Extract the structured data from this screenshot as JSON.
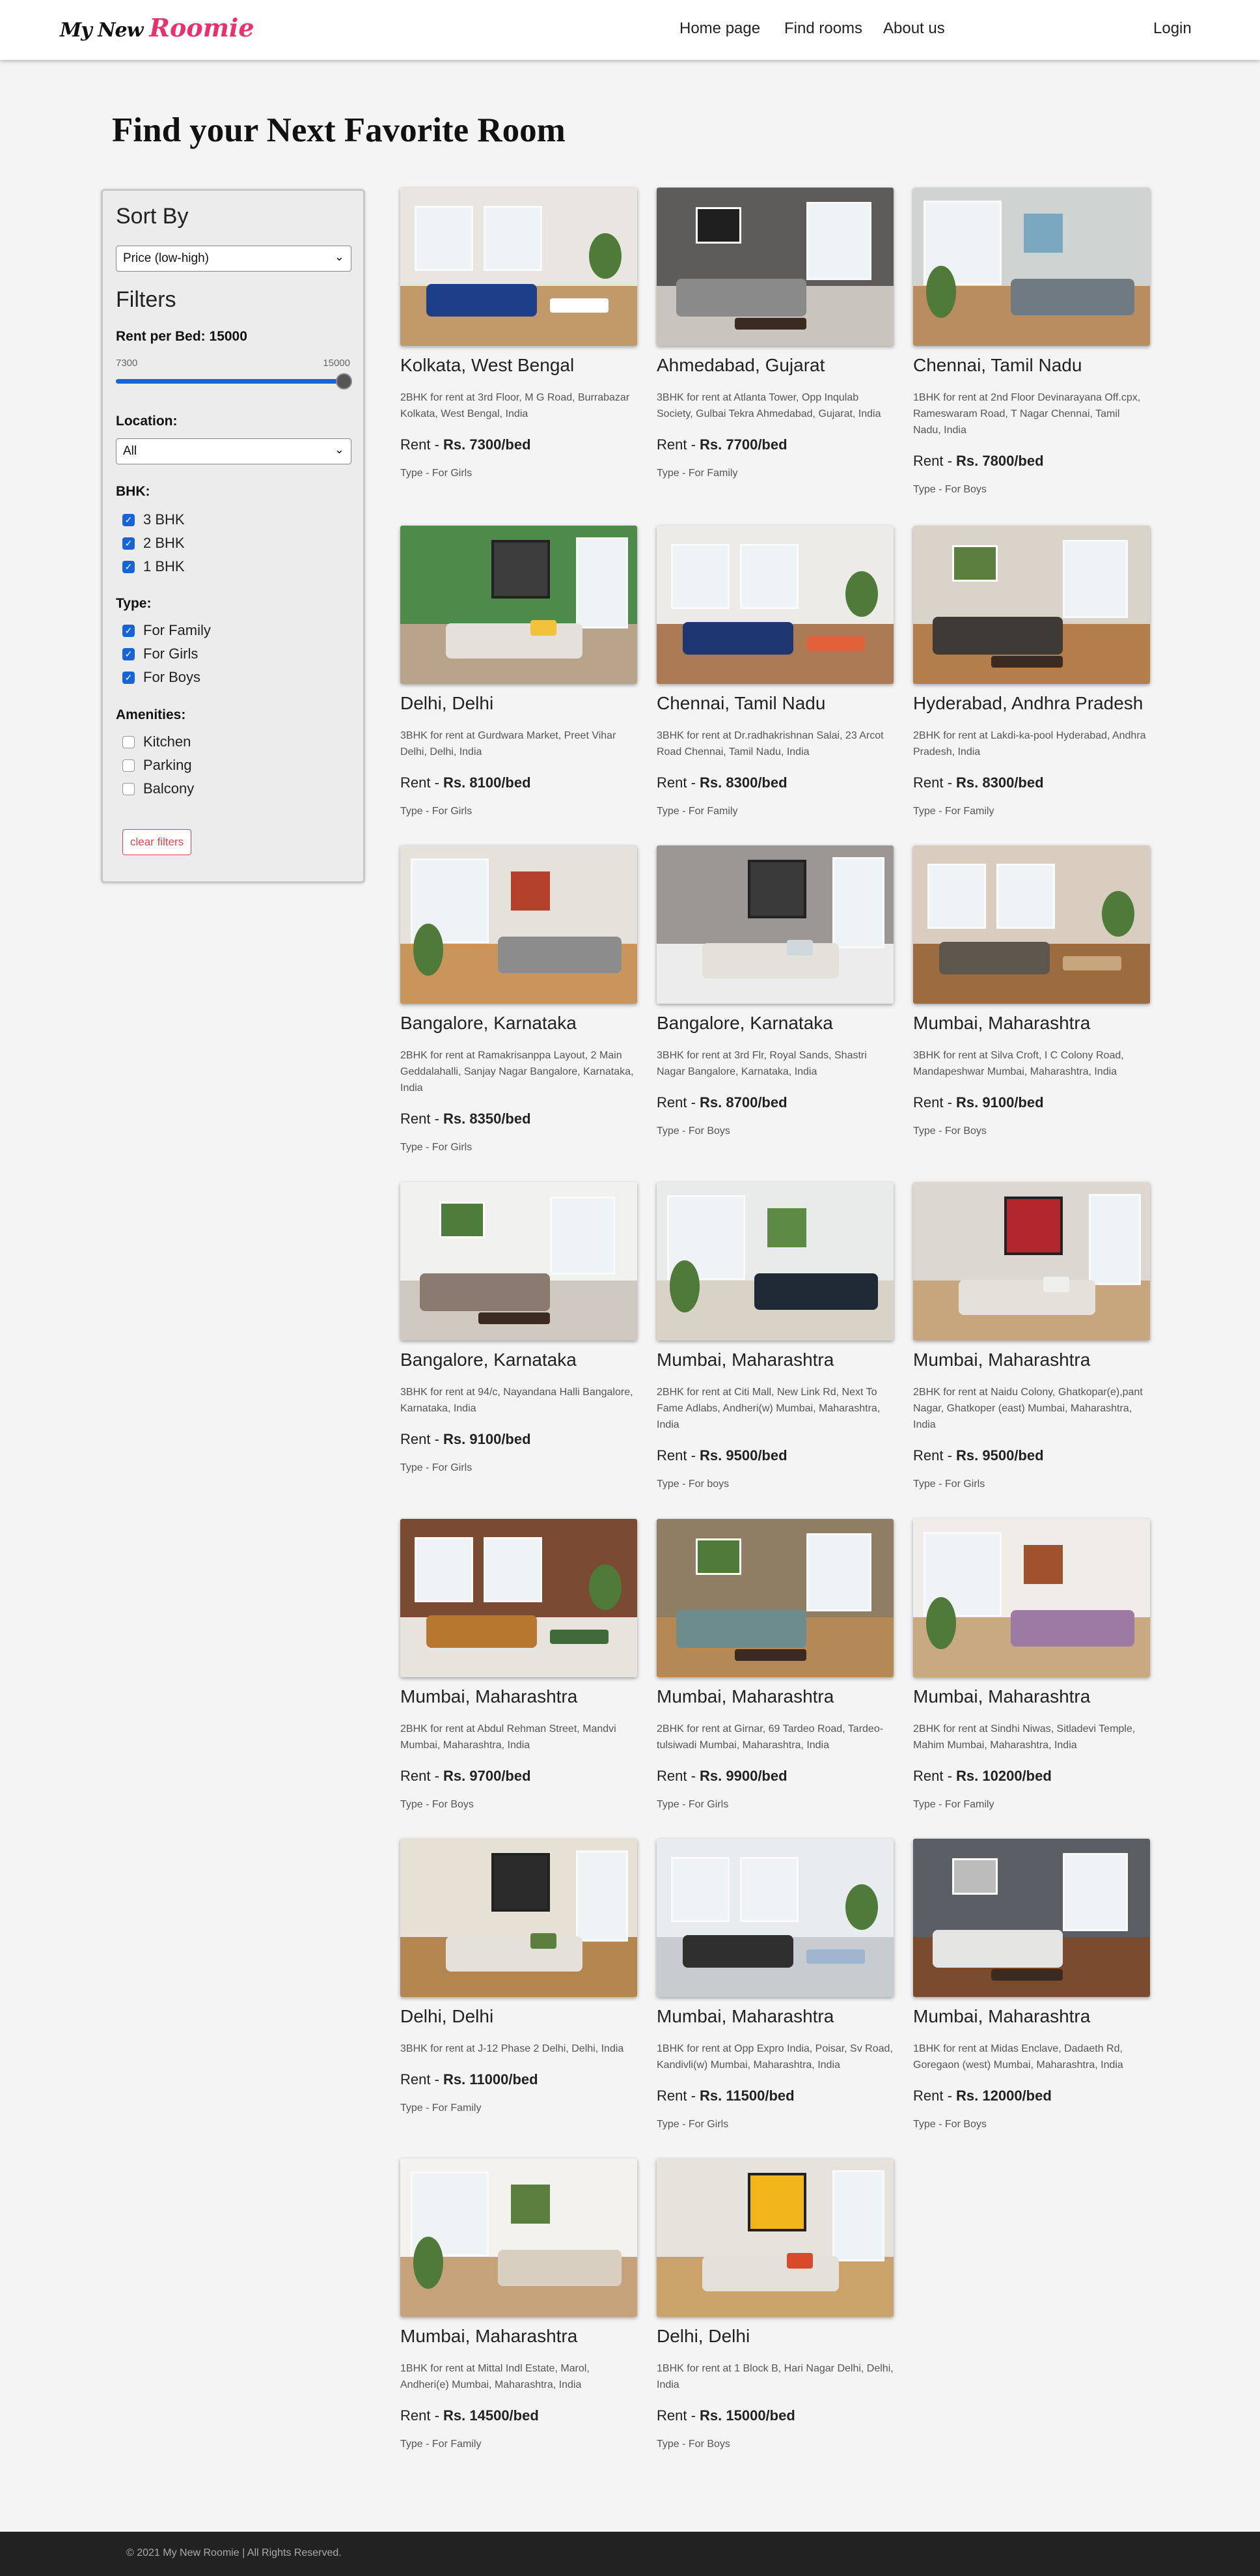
{
  "nav": {
    "logo_my": "My New",
    "logo_roomie": "Roomie",
    "home": "Home page",
    "find": "Find rooms",
    "about": "About us",
    "login": "Login"
  },
  "page_title": "Find your Next Favorite Room",
  "sidebar": {
    "sort_heading": "Sort By",
    "sort_value": "Price (low-high)",
    "filters_heading": "Filters",
    "rent_label": "Rent per Bed: 15000",
    "range_min": "7300",
    "range_max": "15000",
    "slider_fraction": 1.0,
    "location_label": "Location:",
    "location_value": "All",
    "bhk_label": "BHK:",
    "bhk": [
      {
        "label": "3 BHK",
        "checked": true
      },
      {
        "label": "2 BHK",
        "checked": true
      },
      {
        "label": "1 BHK",
        "checked": true
      }
    ],
    "type_label": "Type:",
    "types": [
      {
        "label": "For Family",
        "checked": true
      },
      {
        "label": "For Girls",
        "checked": true
      },
      {
        "label": "For Boys",
        "checked": true
      }
    ],
    "amenities_label": "Amenities:",
    "amenities": [
      {
        "label": "Kitchen",
        "checked": false
      },
      {
        "label": "Parking",
        "checked": false
      },
      {
        "label": "Balcony",
        "checked": false
      }
    ],
    "clear_label": "clear filters"
  },
  "rooms": [
    {
      "city": "Kolkata, West Bengal",
      "desc": "2BHK for rent at 3rd Floor, M G Road, Burrabazar Kolkata, West Bengal, India",
      "rent_prefix": "Rent - ",
      "rent": "Rs. 7300/bed",
      "type": "Type - For Girls",
      "palette": [
        "#e9e6e1",
        "#c29a6a",
        "#1d3f8a",
        "#ffffff"
      ]
    },
    {
      "city": "Ahmedabad, Gujarat",
      "desc": "3BHK for rent at Atlanta Tower, Opp Inqulab Society, Gulbai Tekra Ahmedabad, Gujarat, India",
      "rent_prefix": "Rent - ",
      "rent": "Rs. 7700/bed",
      "type": "Type - For Family",
      "palette": [
        "#5e5c5a",
        "#c9c4bd",
        "#8a8a8a",
        "#1f1f1f"
      ]
    },
    {
      "city": "Chennai, Tamil Nadu",
      "desc": "1BHK for rent at 2nd Floor Devinarayana Off.cpx, Rameswaram Road, T Nagar Chennai, Tamil Nadu, India",
      "rent_prefix": "Rent - ",
      "rent": "Rs. 7800/bed",
      "type": "Type - For Boys",
      "palette": [
        "#cfd3d2",
        "#b98d5f",
        "#6f7a82",
        "#79a8c0"
      ]
    },
    {
      "city": "Delhi, Delhi",
      "desc": "3BHK for rent at Gurdwara Market, Preet Vihar Delhi, Delhi, India",
      "rent_prefix": "Rent - ",
      "rent": "Rs. 8100/bed",
      "type": "Type - For Girls",
      "palette": [
        "#4e8a4a",
        "#b8a48a",
        "#3d3d3d",
        "#f2c23a"
      ]
    },
    {
      "city": "Chennai, Tamil Nadu",
      "desc": "3BHK for rent at Dr.radhakrishnan Salai, 23 Arcot Road Chennai, Tamil Nadu, India",
      "rent_prefix": "Rent - ",
      "rent": "Rs. 8300/bed",
      "type": "Type - For Family",
      "palette": [
        "#ecebe8",
        "#a97a54",
        "#1e3772",
        "#e0613a"
      ]
    },
    {
      "city": "Hyderabad, Andhra Pradesh",
      "desc": "2BHK for rent at Lakdi-ka-pool Hyderabad, Andhra Pradesh, India",
      "rent_prefix": "Rent - ",
      "rent": "Rs. 8300/bed",
      "type": "Type - For Family",
      "palette": [
        "#d9d3c9",
        "#b37e4b",
        "#3e3a36",
        "#5a7f3e"
      ]
    },
    {
      "city": "Bangalore, Karnataka",
      "desc": "2BHK for rent at Ramakrisanppa Layout, 2 Main Geddalahalli, Sanjay Nagar Bangalore, Karnataka, India",
      "rent_prefix": "Rent - ",
      "rent": "Rs. 8350/bed",
      "type": "Type - For Girls",
      "palette": [
        "#e5e2dc",
        "#c9955a",
        "#8c8c8c",
        "#b3402b"
      ]
    },
    {
      "city": "Bangalore, Karnataka",
      "desc": "3BHK for rent at 3rd Flr, Royal Sands, Shastri Nagar Bangalore, Karnataka, India",
      "rent_prefix": "Rent - ",
      "rent": "Rs. 8700/bed",
      "type": "Type - For Boys",
      "palette": [
        "#9a9794",
        "#ececec",
        "#3a3a3a",
        "#cfd8dc"
      ]
    },
    {
      "city": "Mumbai, Maharashtra",
      "desc": "3BHK for rent at Silva Croft, I C Colony Road, Mandapeshwar Mumbai, Maharashtra, India",
      "rent_prefix": "Rent - ",
      "rent": "Rs. 9100/bed",
      "type": "Type - For Boys",
      "palette": [
        "#d8cdbf",
        "#9c6b3f",
        "#5d564d",
        "#c7a57d"
      ]
    },
    {
      "city": "Bangalore, Karnataka",
      "desc": "3BHK for rent at 94/c, Nayandana Halli Bangalore, Karnataka, India",
      "rent_prefix": "Rent - ",
      "rent": "Rs. 9100/bed",
      "type": "Type - For Girls",
      "palette": [
        "#f1f1ef",
        "#cfc9c2",
        "#8a7a70",
        "#4e7d3b"
      ]
    },
    {
      "city": "Mumbai, Maharashtra",
      "desc": "2BHK for rent at Citi Mall, New Link Rd, Next To Fame Adlabs, Andheri(w) Mumbai, Maharashtra, India",
      "rent_prefix": "Rent - ",
      "rent": "Rs. 9500/bed",
      "type": "Type - For boys",
      "palette": [
        "#e9ebea",
        "#d8d2c7",
        "#1f2a36",
        "#5d8a45"
      ]
    },
    {
      "city": "Mumbai, Maharashtra",
      "desc": "2BHK for rent at Naidu Colony, Ghatkopar(e),pant Nagar, Ghatkoper (east) Mumbai, Maharashtra, India",
      "rent_prefix": "Rent - ",
      "rent": "Rs. 9500/bed",
      "type": "Type - For Girls",
      "palette": [
        "#dcd7d0",
        "#c7a57d",
        "#b3262e",
        "#efefed"
      ]
    },
    {
      "city": "Mumbai, Maharashtra",
      "desc": "2BHK for rent at Abdul Rehman Street, Mandvi Mumbai, Maharashtra, India",
      "rent_prefix": "Rent - ",
      "rent": "Rs. 9700/bed",
      "type": "Type - For Boys",
      "palette": [
        "#7a4a33",
        "#e8e4dd",
        "#b8772f",
        "#3f6b3a"
      ]
    },
    {
      "city": "Mumbai, Maharashtra",
      "desc": "2BHK for rent at Girnar, 69 Tardeo Road, Tardeo-tulsiwadi Mumbai, Maharashtra, India",
      "rent_prefix": "Rent - ",
      "rent": "Rs. 9900/bed",
      "type": "Type - For Girls",
      "palette": [
        "#8f7e63",
        "#b58955",
        "#6d8c8e",
        "#4f7a3a"
      ]
    },
    {
      "city": "Mumbai, Maharashtra",
      "desc": "2BHK for rent at Sindhi Niwas, Sitladevi Temple, Mahim Mumbai, Maharashtra, India",
      "rent_prefix": "Rent - ",
      "rent": "Rs. 10200/bed",
      "type": "Type - For Family",
      "palette": [
        "#f0ede8",
        "#c9a982",
        "#9c7aa3",
        "#a0522d"
      ]
    },
    {
      "city": "Delhi, Delhi",
      "desc": "3BHK for rent at J-12 Phase 2 Delhi, Delhi, India",
      "rent_prefix": "Rent - ",
      "rent": "Rs. 11000/bed",
      "type": "Type - For Family",
      "palette": [
        "#e6e0d5",
        "#b3854f",
        "#2b2b2b",
        "#5a7f3e"
      ]
    },
    {
      "city": "Mumbai, Maharashtra",
      "desc": "1BHK for rent at Opp Expro India, Poisar, Sv Road, Kandivli(w) Mumbai, Maharashtra, India",
      "rent_prefix": "Rent - ",
      "rent": "Rs. 11500/bed",
      "type": "Type - For Girls",
      "palette": [
        "#e9ecef",
        "#c7ccd1",
        "#2f2f2f",
        "#9fb4cf"
      ]
    },
    {
      "city": "Mumbai, Maharashtra",
      "desc": "1BHK for rent at Midas Enclave, Dadaeth Rd, Goregaon (west) Mumbai, Maharashtra, India",
      "rent_prefix": "Rent - ",
      "rent": "Rs. 12000/bed",
      "type": "Type - For Boys",
      "palette": [
        "#5a5f66",
        "#7a4b2c",
        "#e5e5e3",
        "#bcbcbc"
      ]
    },
    {
      "city": "Mumbai, Maharashtra",
      "desc": "1BHK for rent at Mittal Indl Estate, Marol, Andheri(e) Mumbai, Maharashtra, India",
      "rent_prefix": "Rent - ",
      "rent": "Rs. 14500/bed",
      "type": "Type - For Family",
      "palette": [
        "#f3f2ef",
        "#c6a27a",
        "#d9cfc1",
        "#5a7f3e"
      ]
    },
    {
      "city": "Delhi, Delhi",
      "desc": "1BHK for rent at 1 Block B, Hari Nagar Delhi, Delhi, India",
      "rent_prefix": "Rent - ",
      "rent": "Rs. 15000/bed",
      "type": "Type - For Boys",
      "palette": [
        "#e6e2dc",
        "#c9a36a",
        "#f2b51b",
        "#d84a2a"
      ]
    }
  ],
  "footer": "© 2021 My New Roomie | All Rights Reserved."
}
